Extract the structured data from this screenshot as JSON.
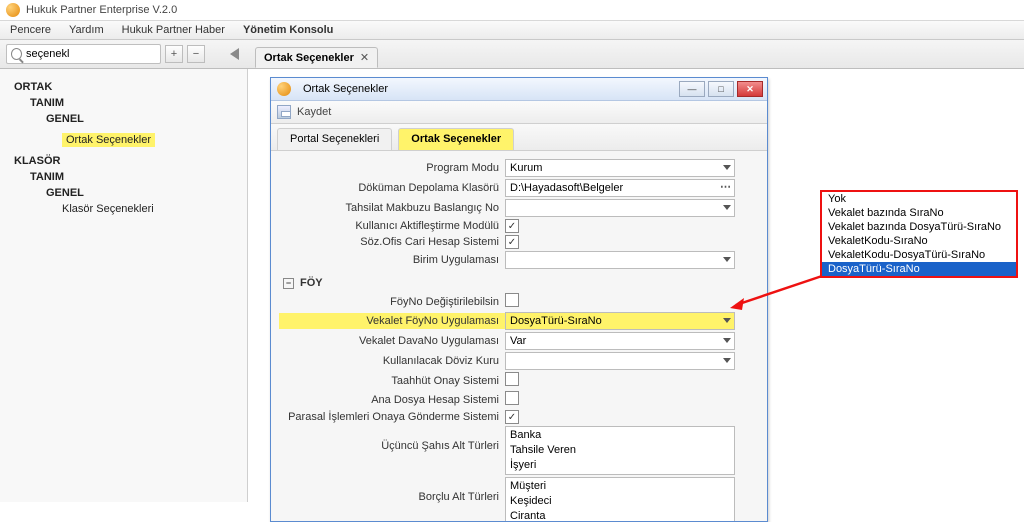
{
  "app": {
    "title": "Hukuk Partner Enterprise V.2.0"
  },
  "menu": {
    "items": [
      "Pencere",
      "Yardım",
      "Hukuk Partner Haber",
      "Yönetim Konsolu"
    ],
    "active_index": 3
  },
  "search": {
    "value": "seçenekl"
  },
  "doc_tab": {
    "label": "Ortak Seçenekler"
  },
  "tree": {
    "n0": "ORTAK",
    "n1": "TANIM",
    "n2": "GENEL",
    "n3": "Ortak Seçenekler",
    "n4": "KLASÖR",
    "n5": "TANIM",
    "n6": "GENEL",
    "n7": "Klasör Seçenekleri"
  },
  "dialog": {
    "title": "Ortak Seçenekler",
    "save": "Kaydet",
    "tabs": {
      "portal": "Portal Seçenekleri",
      "ortak": "Ortak Seçenekler"
    }
  },
  "form": {
    "program_modu": {
      "label": "Program Modu",
      "value": "Kurum"
    },
    "dokuman": {
      "label": "Döküman Depolama Klasörü",
      "value": "D:\\Hayadasoft\\Belgeler"
    },
    "tahsilat": {
      "label": "Tahsilat Makbuzu Baslangıç No",
      "value": ""
    },
    "kullanici_aktif": {
      "label": "Kullanıcı Aktifleştirme Modülü",
      "checked": true
    },
    "soz_ofis": {
      "label": "Söz.Ofis Cari Hesap Sistemi",
      "checked": true
    },
    "birim": {
      "label": "Birim Uygulaması",
      "value": ""
    },
    "section_foy": "FÖY",
    "foyno_deg": {
      "label": "FöyNo Değiştirilebilsin",
      "checked": false
    },
    "vekalet_foyno": {
      "label": "Vekalet FöyNo Uygulaması",
      "value": "DosyaTürü-SıraNo"
    },
    "vekalet_davano": {
      "label": "Vekalet DavaNo Uygulaması",
      "value": "Var"
    },
    "doviz": {
      "label": "Kullanılacak Döviz Kuru",
      "value": ""
    },
    "taahhut": {
      "label": "Taahhüt Onay Sistemi",
      "checked": false
    },
    "ana_dosya": {
      "label": "Ana Dosya Hesap Sistemi",
      "checked": false
    },
    "parasal": {
      "label": "Parasal İşlemleri Onaya Gönderme Sistemi",
      "checked": true
    },
    "ucuncu_sahis": {
      "label": "Üçüncü Şahıs Alt Türleri",
      "values": [
        "Banka",
        "Tahsile Veren",
        "İşyeri"
      ]
    },
    "borclu": {
      "label": "Borçlu Alt Türleri",
      "values": [
        "Müşteri",
        "Keşideci",
        "Ciranta"
      ]
    }
  },
  "popup": {
    "options": [
      "Yok",
      "Vekalet bazında SıraNo",
      "Vekalet bazında DosyaTürü-SıraNo",
      "VekaletKodu-SıraNo",
      "VekaletKodu-DosyaTürü-SıraNo",
      "DosyaTürü-SıraNo"
    ],
    "selected_index": 5
  }
}
